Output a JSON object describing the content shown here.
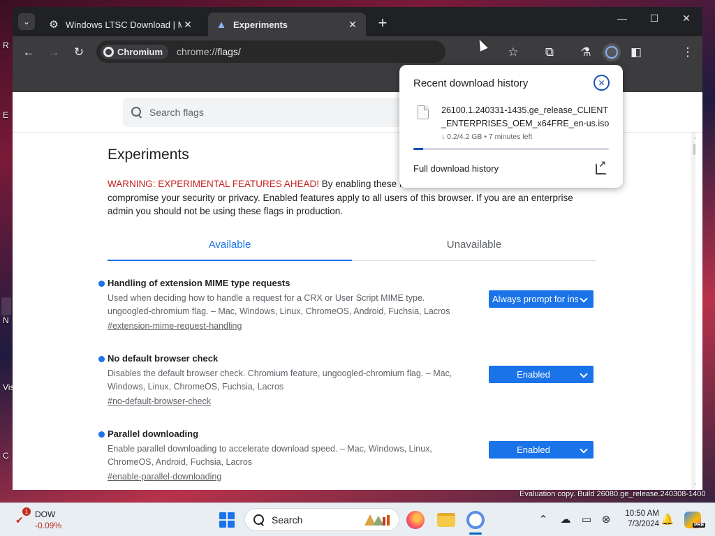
{
  "desktop": {
    "labels": [
      "R",
      "E",
      "N",
      "Vis",
      "C"
    ]
  },
  "browser": {
    "tabs": [
      {
        "title": "Windows LTSC Download | MA",
        "active": false
      },
      {
        "title": "Experiments",
        "active": true
      }
    ],
    "omnibox": {
      "chip_label": "Chromium",
      "url_scheme": "chrome://",
      "url_path": "flags/"
    }
  },
  "flags_page": {
    "search_placeholder": "Search flags",
    "title": "Experiments",
    "warning_prefix": "WARNING: EXPERIMENTAL FEATURES AHEAD!",
    "warning_visible_text": " By enabling these fea",
    "warning_rest": "compromise your security or privacy. Enabled features apply to all users of this browser. If you are an enterprise admin you should not be using these flags in production.",
    "tabs": [
      "Available",
      "Unavailable"
    ],
    "flags": [
      {
        "name": "Handling of extension MIME type requests",
        "description": "Used when deciding how to handle a request for a CRX or User Script MIME type. ungoogled-chromium flag. – Mac, Windows, Linux, ChromeOS, Android, Fuchsia, Lacros",
        "link": "#extension-mime-request-handling",
        "value": "Always prompt for ins"
      },
      {
        "name": "No default browser check",
        "description": "Disables the default browser check. Chromium feature, ungoogled-chromium flag. – Mac, Windows, Linux, ChromeOS, Fuchsia, Lacros",
        "link": "#no-default-browser-check",
        "value": "Enabled"
      },
      {
        "name": "Parallel downloading",
        "description": "Enable parallel downloading to accelerate download speed. – Mac, Windows, Linux, ChromeOS, Android, Fuchsia, Lacros",
        "link": "#enable-parallel-downloading",
        "value": "Enabled"
      }
    ]
  },
  "download_bubble": {
    "title": "Recent download history",
    "filename": "26100.1.240331-1435.ge_release_CLIENT_ENTERPRISES_OEM_x64FRE_en-us.iso",
    "status": "↓ 0.2/4.2 GB • 7 minutes left",
    "progress_percent": 5,
    "full_history_label": "Full download history"
  },
  "watermark": "Evaluation copy. Build 26080.ge_release.240308-1400",
  "taskbar": {
    "stock_badge": "1",
    "stock_name": "DOW",
    "stock_change": "-0.09%",
    "search_label": "Search",
    "time": "10:50 AM",
    "date": "7/3/2024",
    "pre_badge": "PRE"
  },
  "colors": {
    "accent": "#1a73e8",
    "warning_red": "#c5221f",
    "progress": "#1a4fb4"
  }
}
